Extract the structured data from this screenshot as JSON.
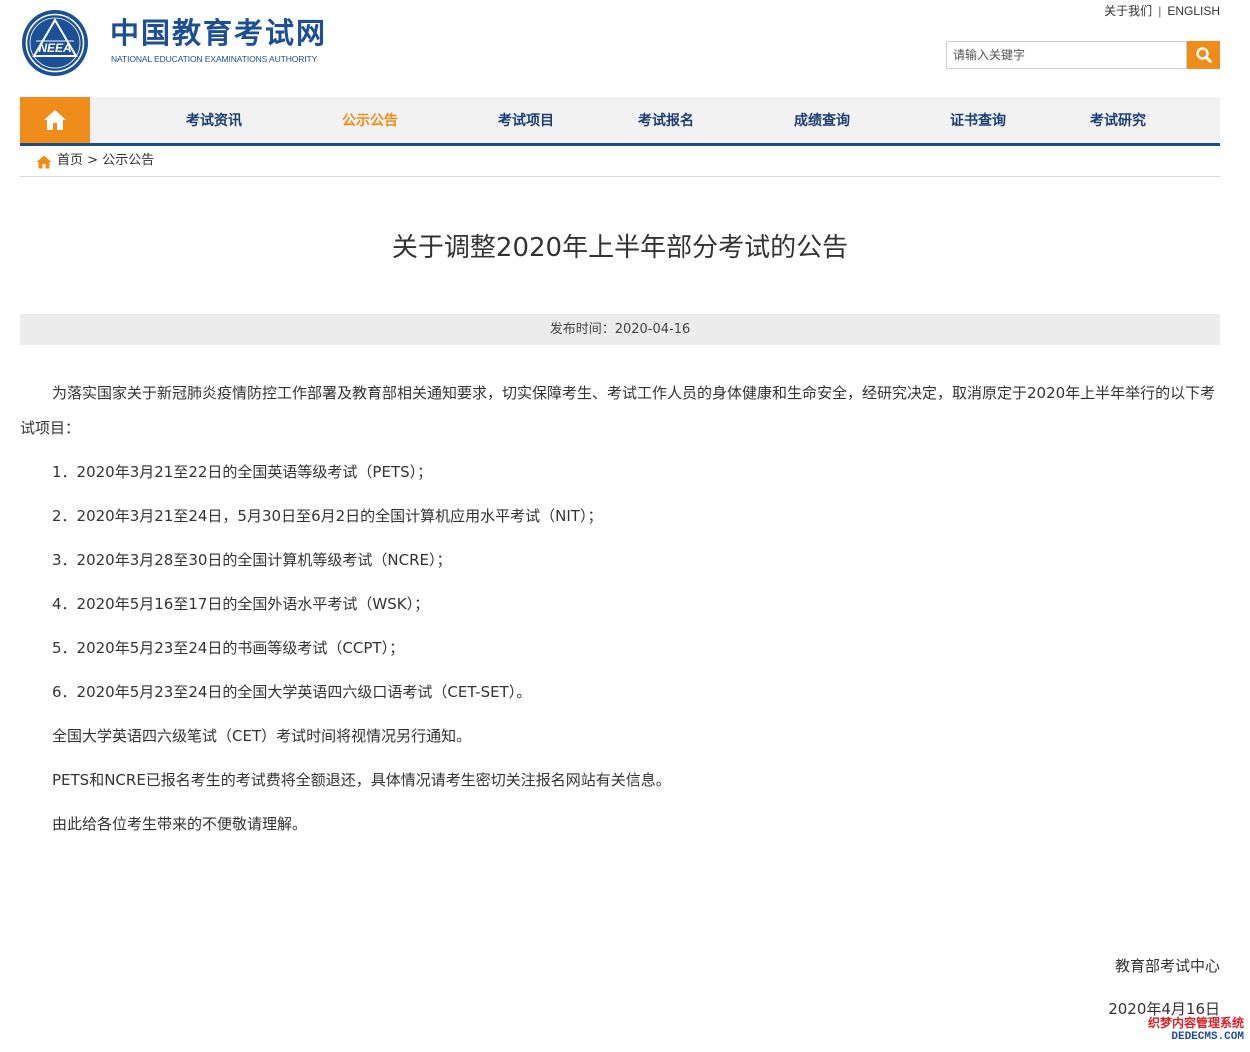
{
  "header": {
    "logo_cn": "中国教育考试网",
    "logo_en": "NATIONAL EDUCATION EXAMINATIONS AUTHORITY",
    "emblem_text": "NEEA",
    "top_links": {
      "about": "关于我们",
      "separator": "|",
      "english": "ENGLISH"
    },
    "search": {
      "placeholder": "请输入关键字",
      "button_icon": "search-icon"
    }
  },
  "nav": {
    "home_icon": "home-icon",
    "items": [
      {
        "label": "考试资讯",
        "active": false
      },
      {
        "label": "公示公告",
        "active": true
      },
      {
        "label": "考试项目",
        "active": false
      },
      {
        "label": "考试报名",
        "active": false
      },
      {
        "label": "成绩查询",
        "active": false
      },
      {
        "label": "证书查询",
        "active": false
      },
      {
        "label": "考试研究",
        "active": false
      }
    ]
  },
  "breadcrumb": {
    "home": "首页",
    "separator": ">",
    "current": "公示公告"
  },
  "article": {
    "title": "关于调整2020年上半年部分考试的公告",
    "publish_label": "发布时间：2020-04-16",
    "intro": "为落实国家关于新冠肺炎疫情防控工作部署及教育部相关通知要求，切实保障考生、考试工作人员的身体健康和生命安全，经研究决定，取消原定于2020年上半年举行的以下考试项目：",
    "items": [
      "1．2020年3月21至22日的全国英语等级考试（PETS）；",
      "2．2020年3月21至24日，5月30日至6月2日的全国计算机应用水平考试（NIT）；",
      "3．2020年3月28至30日的全国计算机等级考试（NCRE）；",
      "4．2020年5月16至17日的全国外语水平考试（WSK）；",
      "5．2020年5月23至24日的书画等级考试（CCPT）；",
      "6．2020年5月23至24日的全国大学英语四六级口语考试（CET-SET）。"
    ],
    "notes": [
      "全国大学英语四六级笔试（CET）考试时间将视情况另行通知。",
      "PETS和NCRE已报名考生的考试费将全额退还，具体情况请考生密切关注报名网站有关信息。",
      "由此给各位考生带来的不便敬请理解。"
    ],
    "signature_org": "教育部考试中心",
    "signature_date": "2020年4月16日"
  },
  "watermark": {
    "line1": "织梦内容管理系统",
    "line2": "DEDECMS.COM"
  },
  "colors": {
    "brand_blue": "#1c4f93",
    "accent_orange": "#f08c1a",
    "nav_border": "#1d4c86"
  }
}
